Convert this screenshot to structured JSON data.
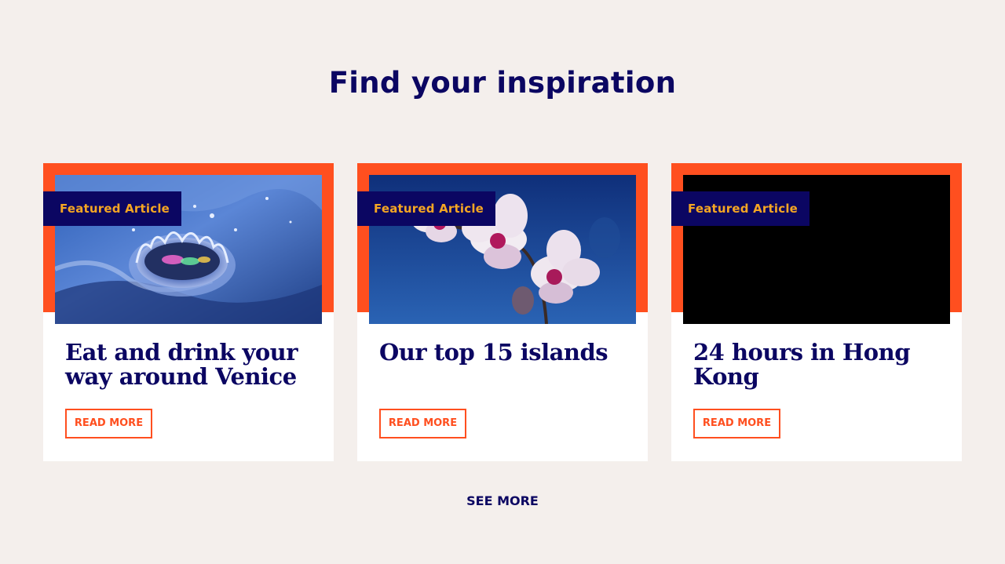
{
  "section": {
    "title": "Find your inspiration"
  },
  "colors": {
    "background": "#f4efec",
    "accent": "#ff4f1f",
    "navy": "#0b0662",
    "badge_text": "#f5a623"
  },
  "cards": [
    {
      "badge": "Featured Article",
      "title": "Eat and drink your way around Venice",
      "cta": "READ MORE",
      "image": "water-drop-splash"
    },
    {
      "badge": "Featured Article",
      "title": "Our top 15 islands",
      "cta": "READ MORE",
      "image": "white-orchid-flowers"
    },
    {
      "badge": "Featured Article",
      "title": "24 hours in Hong Kong",
      "cta": "READ MORE",
      "image": "black-placeholder"
    }
  ],
  "see_more": "SEE MORE"
}
